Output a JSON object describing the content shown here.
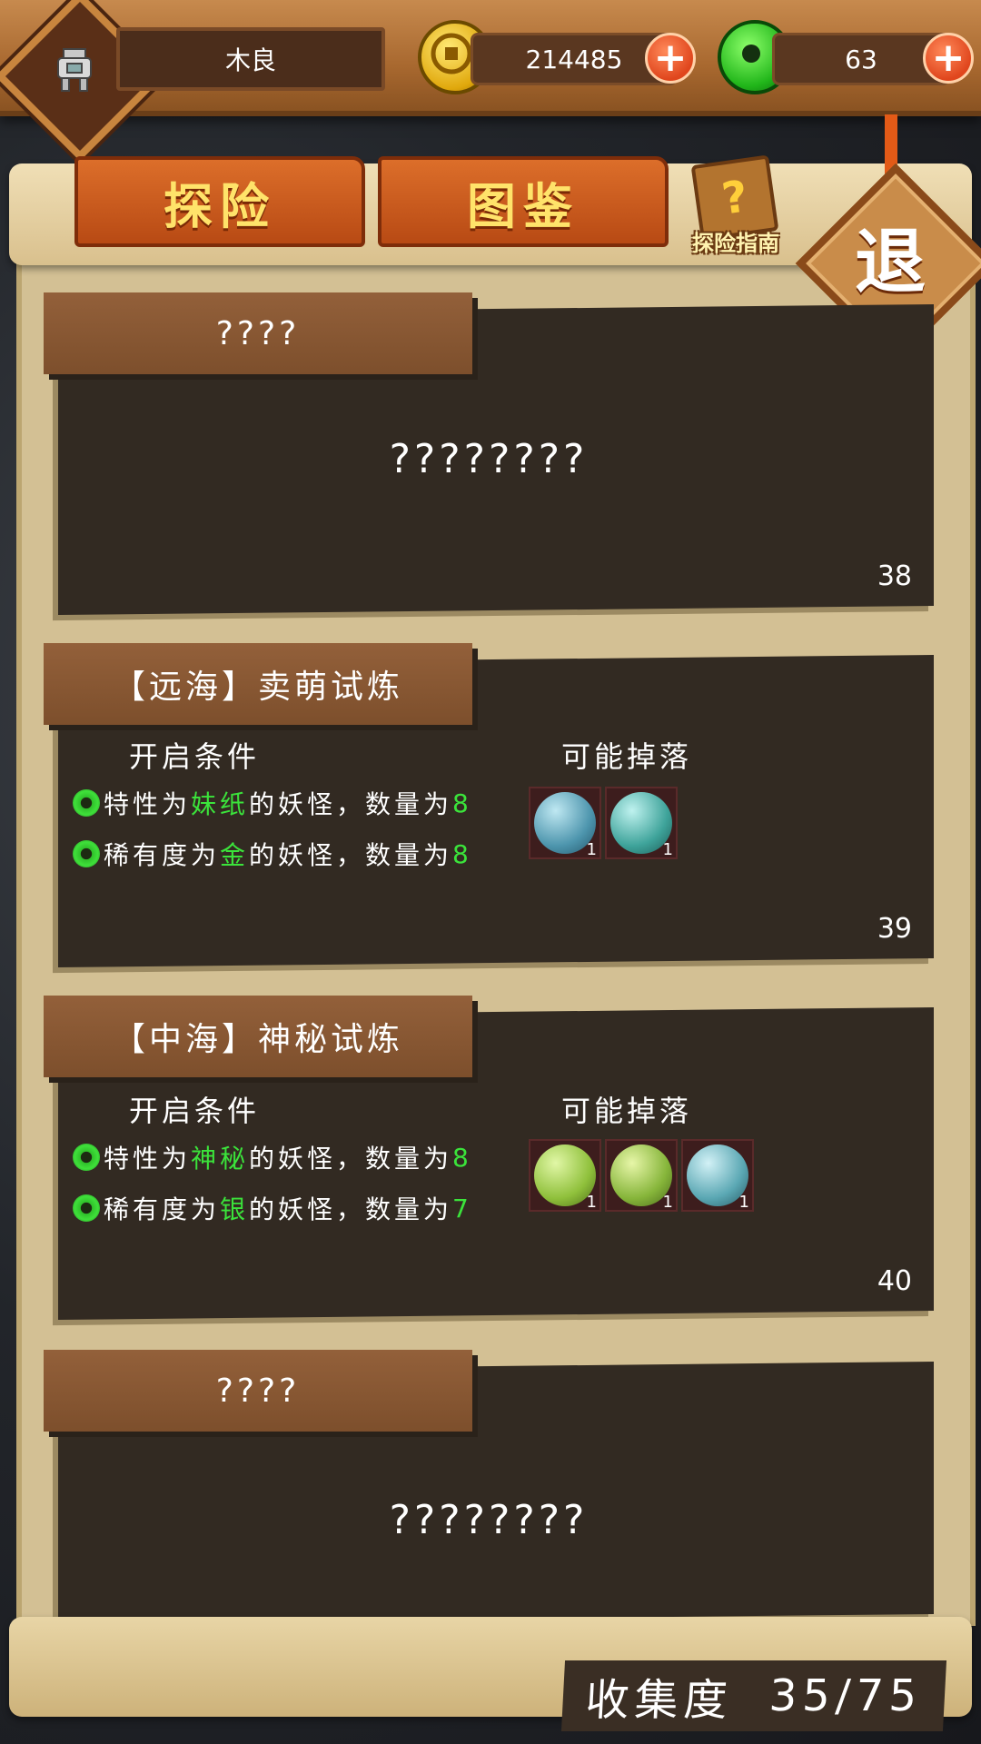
{
  "header": {
    "player_name": "木良",
    "coins": "214485",
    "gems": "63"
  },
  "tabs": {
    "explore": "探险",
    "codex": "图鉴"
  },
  "guide_label": "探险指南",
  "exit_label": "退",
  "cards": [
    {
      "title": "????",
      "body": "????????",
      "number": "38"
    },
    {
      "title": "【远海】卖萌试炼",
      "open_conditions_label": "开启条件",
      "drops_label": "可能掉落",
      "conditions": [
        {
          "pre": "特性为",
          "hl": "妹纸",
          "mid": "的妖怪，数量为",
          "num": "8"
        },
        {
          "pre": "稀有度为",
          "hl": "金",
          "mid": "的妖怪，数量为",
          "num": "8"
        }
      ],
      "drops": [
        {
          "icon": "blue-eye-orb-icon",
          "count": "1"
        },
        {
          "icon": "blue-twin-orb-icon",
          "count": "1"
        }
      ],
      "number": "39"
    },
    {
      "title": "【中海】神秘试炼",
      "open_conditions_label": "开启条件",
      "drops_label": "可能掉落",
      "conditions": [
        {
          "pre": "特性为",
          "hl": "神秘",
          "mid": "的妖怪，数量为",
          "num": "8"
        },
        {
          "pre": "稀有度为",
          "hl": "银",
          "mid": "的妖怪，数量为",
          "num": "7"
        }
      ],
      "drops": [
        {
          "icon": "green-clover-orb-icon",
          "count": "1"
        },
        {
          "icon": "green-petal-orb-icon",
          "count": "1"
        },
        {
          "icon": "teal-house-orb-icon",
          "count": "1"
        }
      ],
      "number": "40"
    },
    {
      "title": "????",
      "body": "????????",
      "number": ""
    }
  ],
  "collection": {
    "label": "收集度",
    "value": "35/75"
  },
  "colors": {
    "highlight_green": "#3be33b",
    "tab_orange": "#dc6e2a",
    "panel_dark": "#322a22"
  }
}
